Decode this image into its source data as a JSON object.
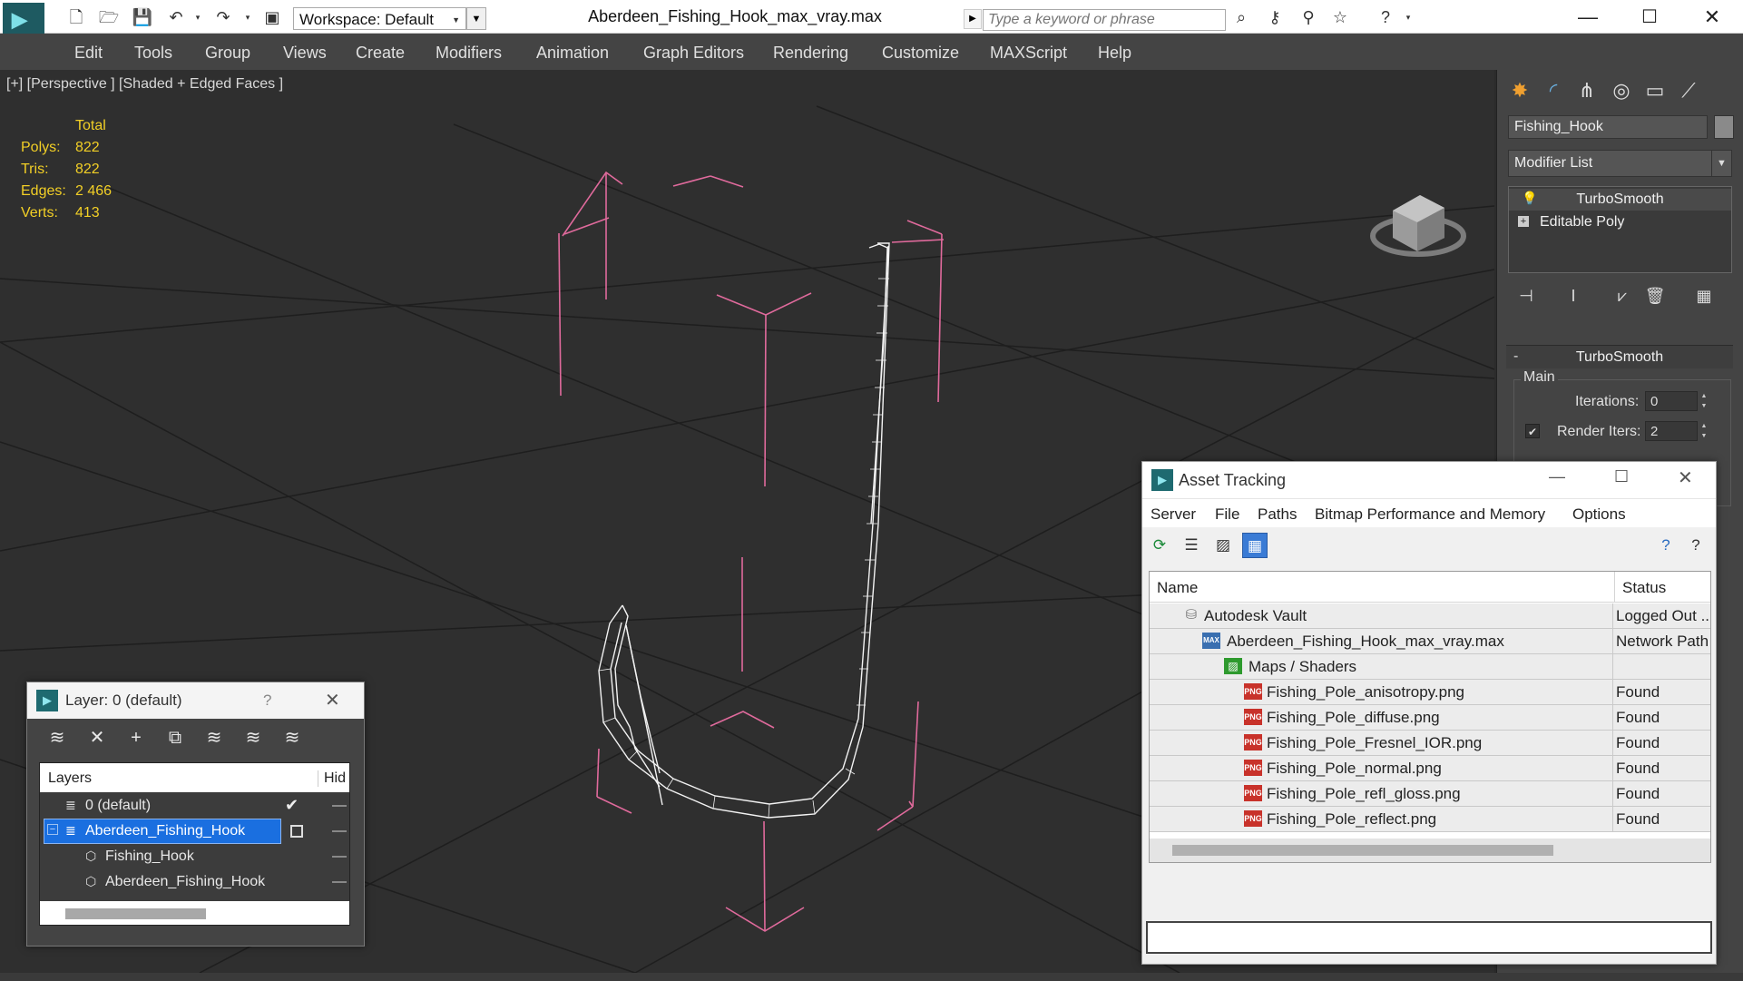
{
  "app": {
    "document_title": "Aberdeen_Fishing_Hook_max_vray.max",
    "workspace_label": "Workspace: Default",
    "search_placeholder": "Type a keyword or phrase"
  },
  "menu": [
    "Edit",
    "Tools",
    "Group",
    "Views",
    "Create",
    "Modifiers",
    "Animation",
    "Graph Editors",
    "Rendering",
    "Customize",
    "MAXScript",
    "Help"
  ],
  "viewport": {
    "label": "[+] [Perspective ] [Shaded + Edged Faces ]",
    "stats_header": "Total",
    "stats": [
      {
        "label": "Polys:",
        "value": "822"
      },
      {
        "label": "Tris:",
        "value": "822"
      },
      {
        "label": "Edges:",
        "value": "2 466"
      },
      {
        "label": "Verts:",
        "value": "413"
      }
    ]
  },
  "command_panel": {
    "object_name": "Fishing_Hook",
    "modifier_list_label": "Modifier List",
    "stack": [
      "TurboSmooth",
      "Editable Poly"
    ],
    "rollout_title": "TurboSmooth",
    "group_label": "Main",
    "iterations_label": "Iterations:",
    "iterations_value": "0",
    "render_iters_label": "Render Iters:",
    "render_iters_value": "2"
  },
  "asset_tracking": {
    "title": "Asset Tracking",
    "menu": [
      "Server",
      "File",
      "Paths",
      "Bitmap Performance and Memory",
      "Options"
    ],
    "columns": [
      "Name",
      "Status"
    ],
    "rows": [
      {
        "name": "Autodesk Vault",
        "status": "Logged Out ...",
        "type": "vault"
      },
      {
        "name": "Aberdeen_Fishing_Hook_max_vray.max",
        "status": "Network Path",
        "type": "max"
      },
      {
        "name": "Maps / Shaders",
        "status": "",
        "type": "maps"
      },
      {
        "name": "Fishing_Pole_anisotropy.png",
        "status": "Found",
        "type": "png"
      },
      {
        "name": "Fishing_Pole_diffuse.png",
        "status": "Found",
        "type": "png"
      },
      {
        "name": "Fishing_Pole_Fresnel_IOR.png",
        "status": "Found",
        "type": "png"
      },
      {
        "name": "Fishing_Pole_normal.png",
        "status": "Found",
        "type": "png"
      },
      {
        "name": "Fishing_Pole_refl_gloss.png",
        "status": "Found",
        "type": "png"
      },
      {
        "name": "Fishing_Pole_reflect.png",
        "status": "Found",
        "type": "png"
      }
    ],
    "png_badge": "PNG",
    "max_badge": "MAX"
  },
  "layer_window": {
    "title": "Layer: 0 (default)",
    "help": "?",
    "columns": [
      "Layers",
      "Hid"
    ],
    "rows": [
      {
        "name": "0 (default)"
      },
      {
        "name": "Aberdeen_Fishing_Hook"
      },
      {
        "name": "Fishing_Hook"
      },
      {
        "name": "Aberdeen_Fishing_Hook"
      }
    ]
  }
}
